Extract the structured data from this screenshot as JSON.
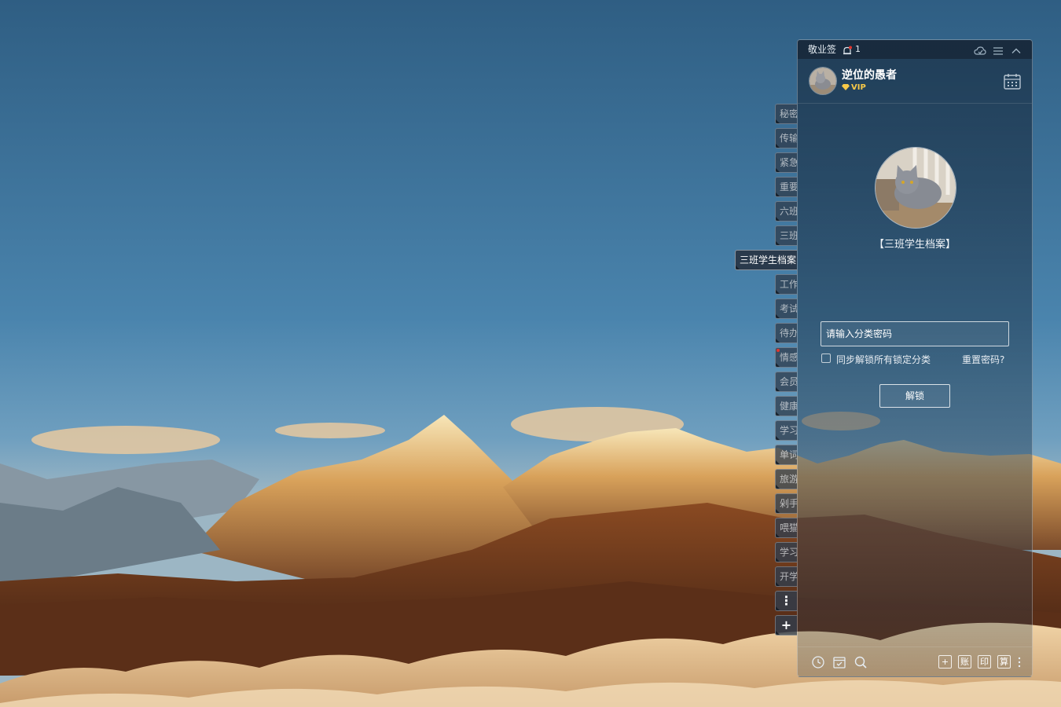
{
  "app": {
    "name": "敬业签",
    "notification_count": "1"
  },
  "user": {
    "name": "逆位的愚者",
    "vip_label": "VIP"
  },
  "category": {
    "name": "【三班学生档案】"
  },
  "unlock_form": {
    "placeholder": "请输入分类密码",
    "sync_label": "同步解锁所有锁定分类",
    "reset_label": "重置密码?",
    "unlock_label": "解锁"
  },
  "side_tabs": [
    "秘密",
    "传输",
    "紧急",
    "重要",
    "六班",
    "三班",
    "三班学生档案",
    "工作",
    "考试",
    "待办",
    "情感",
    "会员",
    "健康",
    "学习",
    "单词",
    "旅游",
    "剁手",
    "喂猫",
    "学习",
    "开学"
  ],
  "side_tab_more": "⋮",
  "side_tab_add": "+",
  "bottom_buttons": {
    "add": "+",
    "account": "账",
    "print": "印",
    "calc": "算"
  },
  "colors": {
    "panel_bg": "#1e3850",
    "accent_vip": "#f7c948",
    "notify_dot": "#e2352e"
  },
  "icons": [
    "bell-icon",
    "cloud-sync-icon",
    "menu-icon",
    "collapse-icon",
    "calendar-icon",
    "clock-icon",
    "task-icon",
    "search-icon",
    "more-icon"
  ]
}
